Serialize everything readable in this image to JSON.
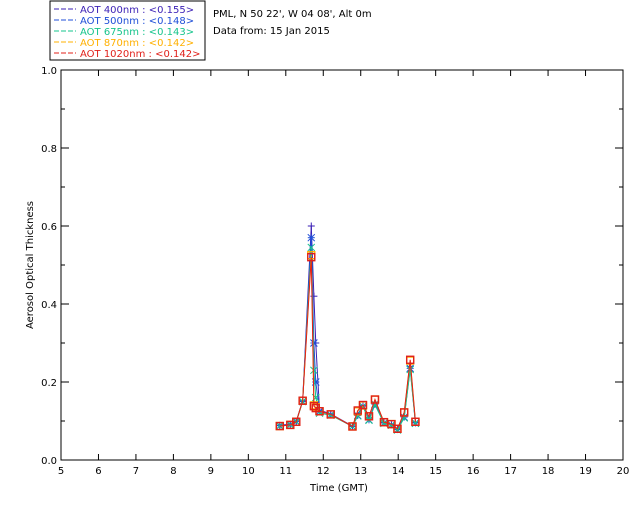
{
  "chart_data": {
    "type": "line",
    "title": "PML, N 50 22', W 04 08', Alt 0m",
    "subtitle": "Data from: 15 Jan 2015",
    "xlabel": "Time (GMT)",
    "ylabel": "Aerosol Optical Thickness",
    "xlim": [
      5,
      20
    ],
    "ylim": [
      0.0,
      1.0
    ],
    "xticks": [
      "5",
      "6",
      "7",
      "8",
      "9",
      "10",
      "11",
      "12",
      "13",
      "14",
      "15",
      "16",
      "17",
      "18",
      "19",
      "20"
    ],
    "yticks": [
      "0.0",
      "0.2",
      "0.4",
      "0.6",
      "0.8",
      "1.0"
    ],
    "grid": false,
    "legend_position": "top-left",
    "x": [
      10.84,
      11.12,
      11.28,
      11.45,
      11.68,
      11.75,
      11.8,
      11.9,
      12.2,
      12.78,
      12.92,
      13.06,
      13.22,
      13.38,
      13.62,
      13.82,
      13.98,
      14.16,
      14.32,
      14.46
    ],
    "series": [
      {
        "name": "AOT 400nm : <0.155>",
        "color": "#3a1fb5",
        "marker": "plus",
        "values": [
          0.089,
          0.092,
          0.1,
          0.152,
          0.6,
          0.42,
          0.3,
          0.128,
          0.118,
          0.087,
          0.116,
          0.14,
          0.105,
          0.145,
          0.097,
          0.092,
          0.08,
          0.112,
          0.24,
          0.097
        ]
      },
      {
        "name": "AOT 500nm : <0.148>",
        "color": "#1f4fd8",
        "marker": "star",
        "values": [
          0.088,
          0.091,
          0.099,
          0.15,
          0.57,
          0.3,
          0.2,
          0.125,
          0.116,
          0.086,
          0.114,
          0.138,
          0.103,
          0.143,
          0.095,
          0.09,
          0.078,
          0.11,
          0.235,
          0.095
        ]
      },
      {
        "name": "AOT 675nm : <0.143>",
        "color": "#16c48c",
        "marker": "x",
        "values": [
          0.087,
          0.09,
          0.098,
          0.15,
          0.545,
          0.23,
          0.16,
          0.12,
          0.115,
          0.086,
          0.113,
          0.137,
          0.102,
          0.142,
          0.094,
          0.089,
          0.077,
          0.108,
          0.232,
          0.094
        ]
      },
      {
        "name": "AOT 870nm : <0.142>",
        "color": "#ffb000",
        "marker": "square",
        "values": [
          0.087,
          0.09,
          0.098,
          0.152,
          0.525,
          0.14,
          0.135,
          0.125,
          0.117,
          0.086,
          0.125,
          0.14,
          0.112,
          0.155,
          0.097,
          0.092,
          0.08,
          0.122,
          0.255,
          0.098
        ]
      },
      {
        "name": "AOT 1020nm : <0.142>",
        "color": "#e0201a",
        "marker": "square",
        "values": [
          0.087,
          0.09,
          0.098,
          0.152,
          0.52,
          0.138,
          0.133,
          0.125,
          0.117,
          0.086,
          0.127,
          0.141,
          0.112,
          0.155,
          0.097,
          0.092,
          0.08,
          0.122,
          0.257,
          0.098
        ]
      }
    ]
  }
}
